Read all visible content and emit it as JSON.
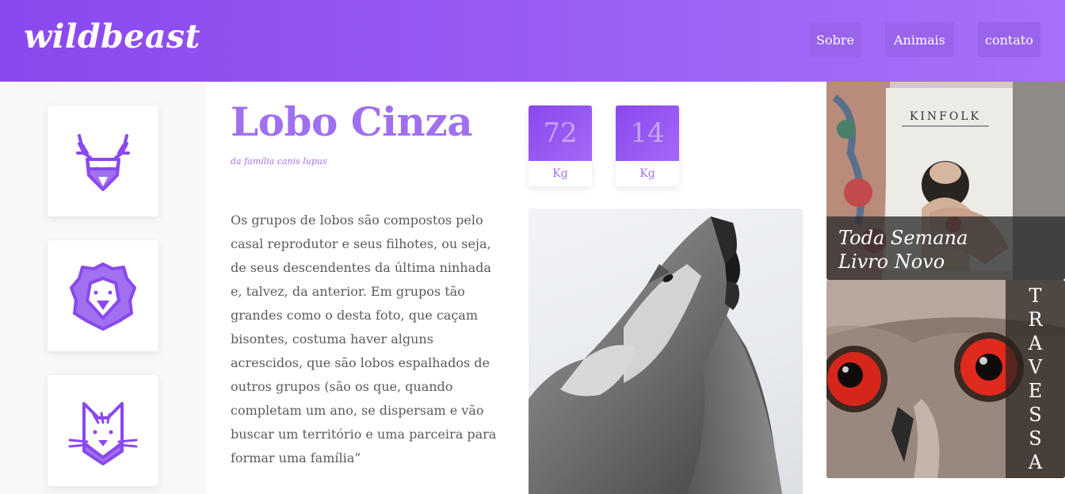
{
  "header": {
    "logo": "wildbeast",
    "nav": [
      {
        "label": "Sobre"
      },
      {
        "label": "Animais"
      },
      {
        "label": "contato"
      }
    ]
  },
  "sidebar": {
    "items": [
      {
        "icon": "deer-icon"
      },
      {
        "icon": "lion-icon"
      },
      {
        "icon": "cat-icon"
      }
    ]
  },
  "main": {
    "title": "Lobo Cinza",
    "subtitle": "da família canis lupus",
    "description": "Os grupos de lobos são compostos pelo casal reprodutor e seus filhotes, ou seja, de seus descendentes da última ninhada e, talvez, da anterior. Em grupos tão grandes como o desta foto, que caçam bisontes, costuma haver alguns acrescidos, que são lobos espalhados de outros grupos (são os que, quando completam um ano, se dispersam e vão buscar um território e uma parceira para formar uma família”",
    "stats": [
      {
        "value": "72",
        "unit": "Kg"
      },
      {
        "value": "14",
        "unit": "Kg"
      }
    ],
    "image": "wolf-howling-photo"
  },
  "aside": {
    "promo1": {
      "caption_line1": "Toda Semana",
      "caption_line2": "Livro Novo",
      "book_title": "KINFOLK"
    },
    "promo2": {
      "letters": [
        "T",
        "R",
        "A",
        "V",
        "E",
        "S",
        "S",
        "A"
      ]
    }
  },
  "colors": {
    "primary": "#8a48ee",
    "accent": "#a070f0",
    "nav_button": "#9a63ec"
  }
}
